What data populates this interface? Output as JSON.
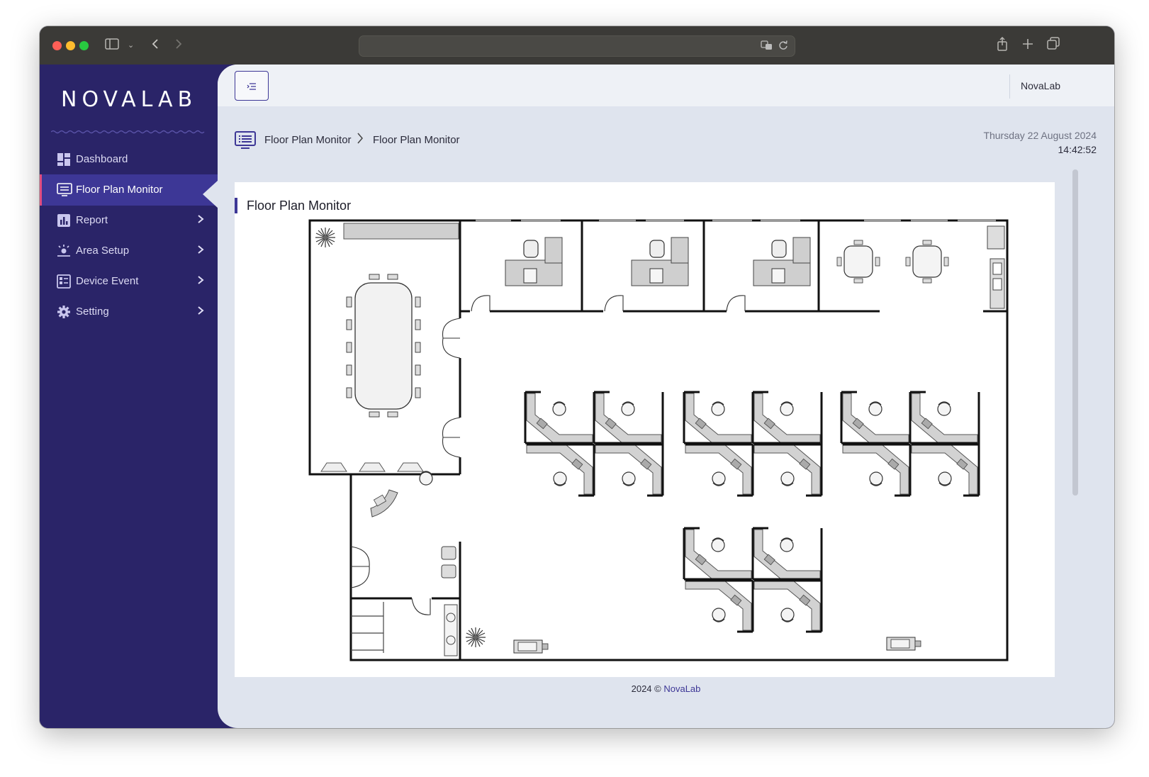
{
  "browser": {
    "url": "",
    "traffic_colors": [
      "#ff5f57",
      "#febc2e",
      "#28c840"
    ]
  },
  "sidebar": {
    "logo": "NOVALAB",
    "items": [
      {
        "label": "Dashboard",
        "icon": "dashboard-icon",
        "active": false,
        "has_submenu": false
      },
      {
        "label": "Floor Plan Monitor",
        "icon": "monitor-icon",
        "active": true,
        "has_submenu": false
      },
      {
        "label": "Report",
        "icon": "report-icon",
        "active": false,
        "has_submenu": true
      },
      {
        "label": "Area Setup",
        "icon": "area-setup-icon",
        "active": false,
        "has_submenu": true
      },
      {
        "label": "Device Event",
        "icon": "device-event-icon",
        "active": false,
        "has_submenu": true
      },
      {
        "label": "Setting",
        "icon": "gear-icon",
        "active": false,
        "has_submenu": true
      }
    ]
  },
  "header": {
    "menu_toggle_icon": "menu-collapse-icon",
    "username": "NovaLab"
  },
  "breadcrumb": {
    "items": [
      "Floor Plan Monitor",
      "Floor Plan Monitor"
    ]
  },
  "datetime": {
    "date": "Thursday 22 August 2024",
    "time": "14:42:52"
  },
  "card": {
    "title": "Floor Plan Monitor"
  },
  "footer": {
    "text": "2024 © ",
    "brand": "NovaLab"
  },
  "colors": {
    "sidebar_bg": "#2a2468",
    "accent": "#3d3796",
    "active_indicator": "#e14d80",
    "main_bg": "#dfe4ee"
  }
}
